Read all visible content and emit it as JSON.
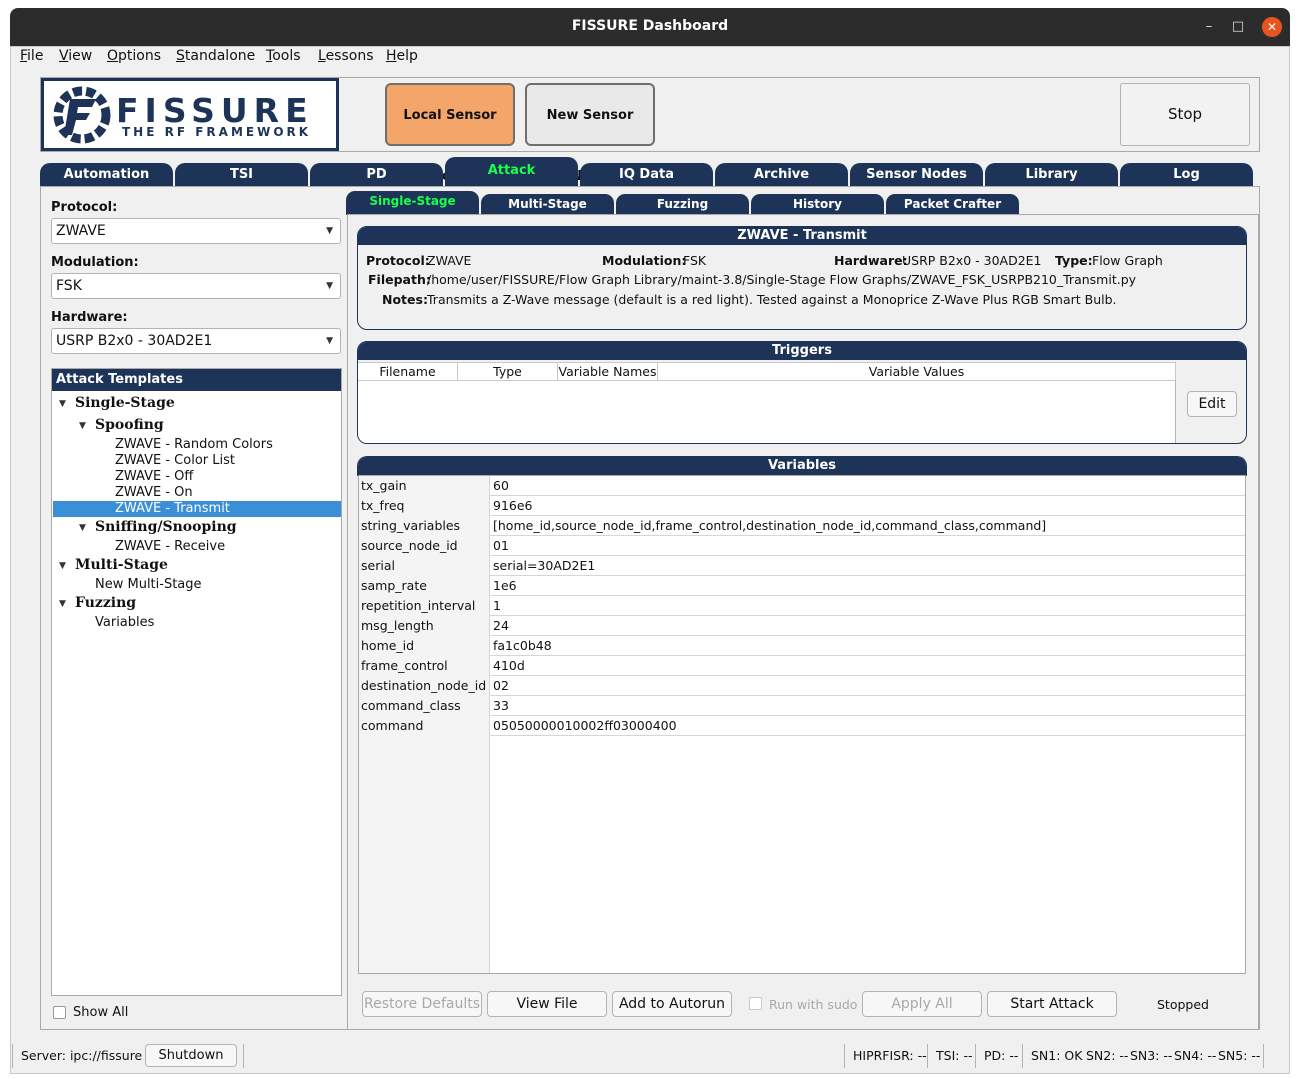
{
  "window": {
    "title": "FISSURE Dashboard",
    "minimize_glyph": "–",
    "maximize_glyph": "□",
    "close_glyph": "✕"
  },
  "menubar": [
    {
      "mnemonic": "F",
      "rest": "ile"
    },
    {
      "mnemonic": "V",
      "rest": "iew"
    },
    {
      "mnemonic": "O",
      "rest": "ptions"
    },
    {
      "mnemonic": "S",
      "rest": "tandalone"
    },
    {
      "mnemonic": "T",
      "rest": "ools"
    },
    {
      "mnemonic": "L",
      "rest": "essons"
    },
    {
      "mnemonic": "H",
      "rest": "elp"
    }
  ],
  "logo": {
    "title": "FISSURE",
    "subtitle": "THE RF FRAMEWORK",
    "color": "#1d3458"
  },
  "top_buttons": {
    "local_sensor_node": "Local Sensor Node",
    "new_sensor_node": "New Sensor Node",
    "stop": "Stop"
  },
  "main_tabs": [
    "Automation",
    "TSI",
    "PD",
    "Attack",
    "IQ Data",
    "Archive",
    "Sensor Nodes",
    "Library",
    "Log"
  ],
  "active_main_tab": "Attack",
  "left_panel": {
    "protocol_label": "Protocol:",
    "protocol_value": "ZWAVE",
    "modulation_label": "Modulation:",
    "modulation_value": "FSK",
    "hardware_label": "Hardware:",
    "hardware_value": "USRP B2x0 - 30AD2E1",
    "tree_header": "Attack Templates",
    "tree": {
      "single_stage": "Single-Stage",
      "spoofing": "Spoofing",
      "spoofing_items": [
        "ZWAVE - Random Colors",
        "ZWAVE - Color List",
        "ZWAVE - Off",
        "ZWAVE - On",
        "ZWAVE - Transmit"
      ],
      "sniffing": "Sniffing/Snooping",
      "sniffing_items": [
        "ZWAVE - Receive"
      ],
      "multi_stage": "Multi-Stage",
      "multi_stage_items": [
        "New Multi-Stage"
      ],
      "fuzzing": "Fuzzing",
      "fuzzing_items": [
        "Variables"
      ],
      "selected": "ZWAVE - Transmit"
    },
    "show_all_label": "Show All"
  },
  "sub_tabs": [
    "Single-Stage",
    "Multi-Stage",
    "Fuzzing",
    "History",
    "Packet Crafter"
  ],
  "active_sub_tab": "Single-Stage",
  "info": {
    "header": "ZWAVE - Transmit",
    "protocol_label": "Protocol:",
    "protocol_value": "ZWAVE",
    "modulation_label": "Modulation:",
    "modulation_value": "FSK",
    "hardware_label": "Hardware:",
    "hardware_value": "USRP B2x0 - 30AD2E1",
    "type_label": "Type:",
    "type_value": "Flow Graph",
    "filepath_label": "Filepath:",
    "filepath_value": "/home/user/FISSURE/Flow Graph Library/maint-3.8/Single-Stage Flow Graphs/ZWAVE_FSK_USRPB210_Transmit.py",
    "notes_label": "Notes:",
    "notes_value": "Transmits a Z-Wave message (default is a red light). Tested against a Monoprice Z-Wave Plus RGB Smart Bulb."
  },
  "triggers": {
    "header": "Triggers",
    "columns": [
      "Filename",
      "Type",
      "Variable Names",
      "Variable Values"
    ],
    "edit_label": "Edit"
  },
  "variables": {
    "header": "Variables",
    "rows": [
      {
        "name": "tx_gain",
        "value": "60"
      },
      {
        "name": "tx_freq",
        "value": "916e6"
      },
      {
        "name": "string_variables",
        "value": "[home_id,source_node_id,frame_control,destination_node_id,command_class,command]"
      },
      {
        "name": "source_node_id",
        "value": "01"
      },
      {
        "name": "serial",
        "value": "serial=30AD2E1"
      },
      {
        "name": "samp_rate",
        "value": "1e6"
      },
      {
        "name": "repetition_interval",
        "value": "1"
      },
      {
        "name": "msg_length",
        "value": "24"
      },
      {
        "name": "home_id",
        "value": "fa1c0b48"
      },
      {
        "name": "frame_control",
        "value": "410d"
      },
      {
        "name": "destination_node_id",
        "value": "02"
      },
      {
        "name": "command_class",
        "value": "33"
      },
      {
        "name": "command",
        "value": "05050000010002ff03000400"
      }
    ]
  },
  "bottom_bar": {
    "restore_defaults": "Restore Defaults",
    "view_file": "View File",
    "add_to_autorun": "Add to Autorun",
    "run_with_sudo": "Run with sudo",
    "apply_all": "Apply All",
    "start_attack": "Start Attack",
    "status": "Stopped"
  },
  "statusbar": {
    "server": "Server:  ipc://fissure",
    "shutdown": "Shutdown",
    "hiprfisr": "HIPRFISR: --",
    "tsi": "TSI: --",
    "pd": "PD: --",
    "sn1": "SN1: OK",
    "sn2": "SN2: --",
    "sn3": "SN3: --",
    "sn4": "SN4: --",
    "sn5": "SN5: --"
  },
  "colors": {
    "navy": "#1d3458",
    "active_tab_text": "#1aff4a",
    "local_sensor_button": "#f3a56a",
    "selection": "#3b8fd6",
    "close_button": "#e95420"
  }
}
